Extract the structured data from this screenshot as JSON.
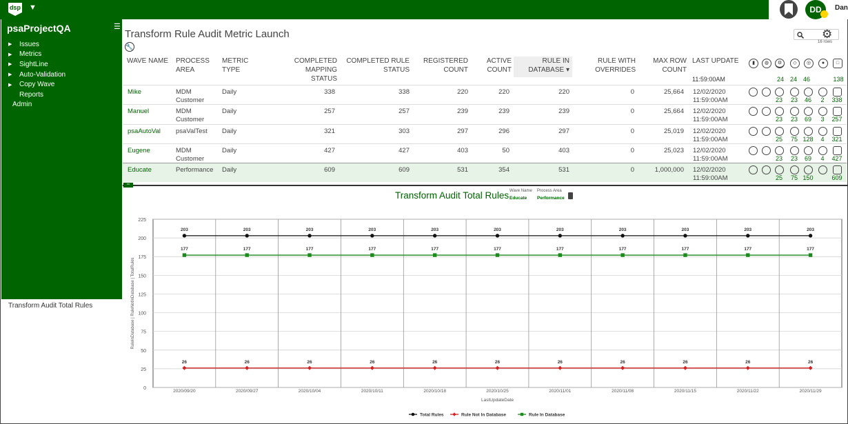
{
  "app": {
    "logo_text": "dsp",
    "project_title": "psaProjectQA"
  },
  "user": {
    "initials": "DD",
    "name": "Dan"
  },
  "sidebar": {
    "items": [
      {
        "label": "Issues",
        "arrow": true
      },
      {
        "label": "Metrics",
        "arrow": true
      },
      {
        "label": "SightLine",
        "arrow": true
      },
      {
        "label": "Auto-Validation",
        "arrow": true
      },
      {
        "label": "Copy Wave",
        "arrow": true
      },
      {
        "label": "Reports",
        "arrow": false
      },
      {
        "label": "Admin",
        "arrow": false
      }
    ],
    "footer": "Transform Audit Total Rules"
  },
  "page": {
    "title": "Transform Rule Audit Metric Launch",
    "row_count": "16 rows"
  },
  "table": {
    "headers": {
      "wave_name": "WAVE NAME",
      "process_area_1": "PROCESS",
      "process_area_2": "AREA",
      "metric_type_1": "METRIC",
      "metric_type_2": "TYPE",
      "completed_mapping_1": "COMPLETED MAPPING",
      "completed_mapping_2": "STATUS",
      "completed_rule_1": "COMPLETED RULE",
      "completed_rule_2": "STATUS",
      "registered_1": "REGISTERED",
      "registered_2": "COUNT",
      "active_1": "ACTIVE",
      "active_2": "COUNT",
      "rule_in_db_1": "RULE IN",
      "rule_in_db_2": "DATABASE ▾",
      "overrides_1": "RULE WITH",
      "overrides_2": "OVERRIDES",
      "max_row_1": "MAX ROW",
      "max_row_2": "COUNT",
      "last_update": "LAST UPDATE"
    },
    "partial_row": {
      "time": "11:59:00AM",
      "icon_counts": [
        "24",
        "24",
        "46",
        "",
        "138"
      ]
    },
    "rows": [
      {
        "wave": "Mike",
        "area1": "MDM",
        "area2": "Customer",
        "type": "Daily",
        "mapping": "338",
        "rule": "338",
        "registered": "220",
        "active": "220",
        "in_db": "220",
        "overrides": "0",
        "max_row": "25,664",
        "date": "12/02/2020",
        "time": "11:59:00AM",
        "counts": [
          "23",
          "23",
          "46",
          "2",
          "338"
        ],
        "selected": false
      },
      {
        "wave": "Manuel",
        "area1": "MDM",
        "area2": "Customer",
        "type": "Daily",
        "mapping": "257",
        "rule": "257",
        "registered": "239",
        "active": "239",
        "in_db": "239",
        "overrides": "0",
        "max_row": "25,664",
        "date": "12/02/2020",
        "time": "11:59:00AM",
        "counts": [
          "23",
          "23",
          "69",
          "3",
          "257"
        ],
        "selected": false
      },
      {
        "wave": "psaAutoVal",
        "area1": "psaValTest",
        "area2": "",
        "type": "Daily",
        "mapping": "321",
        "rule": "303",
        "registered": "297",
        "active": "296",
        "in_db": "297",
        "overrides": "0",
        "max_row": "25,019",
        "date": "12/02/2020",
        "time": "11:59:00AM",
        "counts": [
          "25",
          "75",
          "128",
          "4",
          "321"
        ],
        "selected": false
      },
      {
        "wave": "Eugene",
        "area1": "MDM",
        "area2": "Customer",
        "type": "Daily",
        "mapping": "427",
        "rule": "427",
        "registered": "403",
        "active": "50",
        "in_db": "403",
        "overrides": "0",
        "max_row": "25,023",
        "date": "12/02/2020",
        "time": "11:59:00AM",
        "counts": [
          "23",
          "23",
          "69",
          "4",
          "427"
        ],
        "selected": false
      },
      {
        "wave": "Educate",
        "area1": "Performance",
        "area2": "",
        "type": "Daily",
        "mapping": "609",
        "rule": "609",
        "registered": "531",
        "active": "354",
        "in_db": "531",
        "overrides": "0",
        "max_row": "1,000,000",
        "date": "12/02/2020",
        "time": "11:59:00AM",
        "counts": [
          "25",
          "75",
          "150",
          "",
          "609"
        ],
        "selected": true
      }
    ]
  },
  "chart_panel": {
    "title": "Transform Audit Total Rules",
    "wave_name_label": "Wave Name",
    "wave_name_value": "Educate",
    "process_area_label": "Process Area",
    "process_area_value": "Performance"
  },
  "chart_data": {
    "type": "line",
    "title": "Transform Audit Total Rules",
    "xlabel": "LastUpdateDate",
    "ylabel": "RuleInDatabase | RuleNotInDatabase | TotalRules",
    "ylim": [
      0,
      225
    ],
    "yticks": [
      0,
      25,
      50,
      75,
      100,
      125,
      150,
      175,
      200,
      225
    ],
    "grid": true,
    "legend_position": "bottom",
    "categories": [
      "2020/09/20",
      "2020/09/27",
      "2020/10/04",
      "2020/10/11",
      "2020/10/18",
      "2020/10/25",
      "2020/11/01",
      "2020/11/08",
      "2020/11/15",
      "2020/11/22",
      "2020/11/29"
    ],
    "series": [
      {
        "name": "Total Rules",
        "color": "#111111",
        "marker": "circle",
        "values": [
          203,
          203,
          203,
          203,
          203,
          203,
          203,
          203,
          203,
          203,
          203
        ]
      },
      {
        "name": "Rule Not In Database",
        "color": "#d62020",
        "marker": "diamond",
        "values": [
          26,
          26,
          26,
          26,
          26,
          26,
          26,
          26,
          26,
          26,
          26
        ]
      },
      {
        "name": "Rule In Database",
        "color": "#1a8a1a",
        "marker": "square",
        "values": [
          177,
          177,
          177,
          177,
          177,
          177,
          177,
          177,
          177,
          177,
          177
        ]
      }
    ]
  }
}
